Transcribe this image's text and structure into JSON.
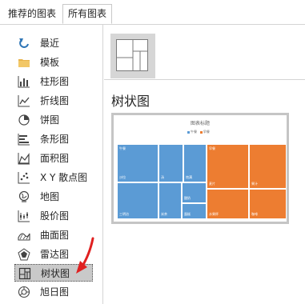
{
  "tabs": [
    {
      "label": "推荐的图表",
      "active": false
    },
    {
      "label": "所有图表",
      "active": true
    }
  ],
  "categories": [
    {
      "label": "最近",
      "icon": "recent-icon"
    },
    {
      "label": "模板",
      "icon": "folder-icon"
    },
    {
      "label": "柱形图",
      "icon": "column-chart-icon"
    },
    {
      "label": "折线图",
      "icon": "line-chart-icon"
    },
    {
      "label": "饼图",
      "icon": "pie-chart-icon"
    },
    {
      "label": "条形图",
      "icon": "bar-chart-icon"
    },
    {
      "label": "面积图",
      "icon": "area-chart-icon"
    },
    {
      "label": "X Y 散点图",
      "icon": "scatter-chart-icon"
    },
    {
      "label": "地图",
      "icon": "map-chart-icon"
    },
    {
      "label": "股价图",
      "icon": "stock-chart-icon"
    },
    {
      "label": "曲面图",
      "icon": "surface-chart-icon"
    },
    {
      "label": "雷达图",
      "icon": "radar-chart-icon"
    },
    {
      "label": "树状图",
      "icon": "treemap-icon",
      "selected": true
    },
    {
      "label": "旭日图",
      "icon": "sunburst-icon"
    }
  ],
  "panel": {
    "title": "树状图",
    "preview": {
      "chart_title": "图表标题",
      "legend": [
        {
          "name": "午餐",
          "color": "#5b9bd5"
        },
        {
          "name": "早餐",
          "color": "#ed7d31"
        }
      ],
      "parents": [
        {
          "name": "午餐",
          "color": "#5b9bd5"
        },
        {
          "name": "早餐",
          "color": "#ed7d31"
        }
      ],
      "leaves": [
        "沙拉",
        "汤",
        "饱满",
        "酸奶",
        "三明治",
        "米茶",
        "蛋糕",
        "麦片",
        "果汁",
        "水果杯",
        "咖啡"
      ]
    }
  },
  "colors": {
    "accent_red": "#e02020",
    "selected_bg": "#c9c9c9"
  }
}
